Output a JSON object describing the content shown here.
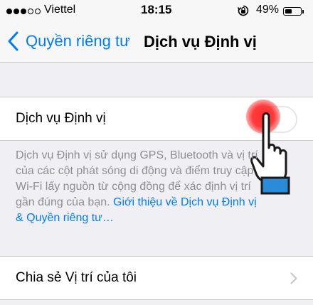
{
  "status_bar": {
    "carrier": "Viettel",
    "time": "18:15",
    "battery_percent": "49%",
    "battery_level": 0.49,
    "signal_bars": 3,
    "signal_total": 5
  },
  "nav": {
    "back_label": "Quyền riêng tư",
    "title": "Dịch vụ Định vị"
  },
  "location_services": {
    "label": "Dịch vụ Định vị",
    "enabled": false
  },
  "footer": {
    "text": "Dịch vụ Định vị sử dụng GPS, Bluetooth và vị trí của các cột phát sóng di động và điểm truy cập Wi-Fi lấy nguồn từ cộng đồng để xác định vị trí gần đúng của bạn. ",
    "link_text": "Giới thiệu về Dịch vụ Định vị & Quyền riêng tư…"
  },
  "share_location": {
    "label": "Chia sẻ Vị trí của tôi"
  },
  "colors": {
    "accent": "#007aff",
    "background": "#efeff4",
    "secondary_text": "#8e8e93",
    "tap_indicator": "#ff2a2a"
  }
}
